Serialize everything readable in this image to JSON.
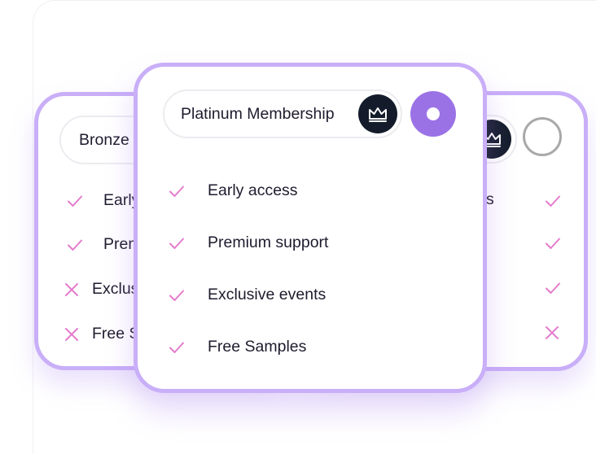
{
  "plans": {
    "bronze": {
      "title": "Bronze",
      "features": [
        {
          "label": "Early",
          "icon": "check-icon"
        },
        {
          "label": "Prem",
          "icon": "check-icon"
        },
        {
          "label": "Exclus",
          "icon": "cross-icon"
        },
        {
          "label": "Free S",
          "icon": "cross-icon"
        }
      ],
      "selected": false
    },
    "platinum": {
      "title": "Platinum Membership",
      "icon": "crown-icon",
      "features": [
        {
          "label": "Early access",
          "icon": "check-icon"
        },
        {
          "label": "Premium support",
          "icon": "check-icon"
        },
        {
          "label": "Exclusive events",
          "icon": "check-icon"
        },
        {
          "label": "Free Samples",
          "icon": "check-icon"
        }
      ],
      "selected": true
    },
    "gold": {
      "icon": "crown-icon",
      "partial_text": "s",
      "features": [
        {
          "icon": "check-icon"
        },
        {
          "icon": "check-icon"
        },
        {
          "icon": "check-icon"
        },
        {
          "icon": "cross-icon"
        }
      ],
      "selected": false
    }
  },
  "colors": {
    "card_border": "#c9aef8",
    "accent": "#9b72e6",
    "mark": "#e47ccd",
    "badge": "#141c2b",
    "text": "#1f1b2e",
    "radio_off": "#a9a9a9"
  }
}
